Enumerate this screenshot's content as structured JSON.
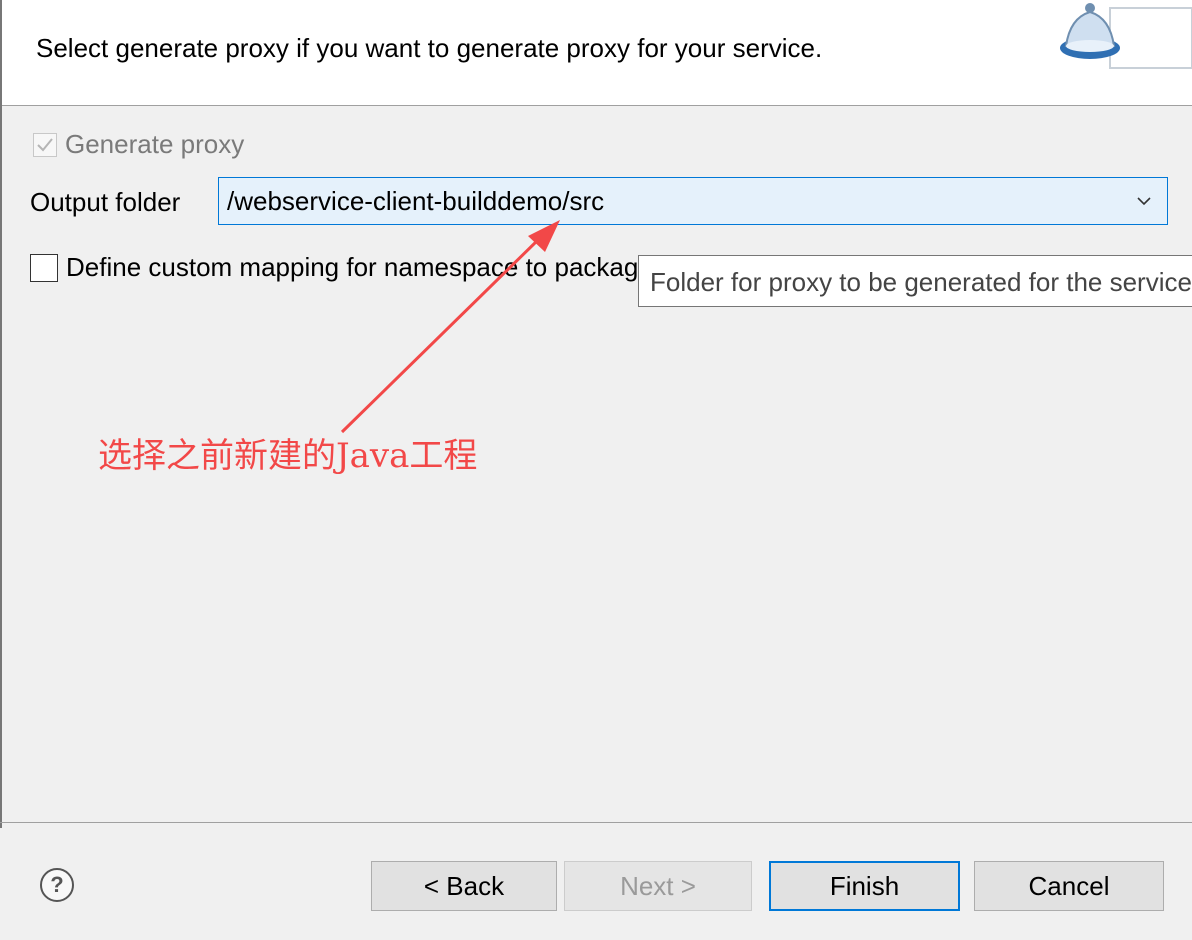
{
  "header": {
    "description": "Select generate proxy if you want to generate proxy for your service."
  },
  "generate_proxy": {
    "label": "Generate proxy",
    "checked": true,
    "enabled": false
  },
  "output_folder": {
    "label": "Output folder",
    "value": "/webservice-client-builddemo/src"
  },
  "custom_mapping": {
    "label": "Define custom mapping for namespace to package",
    "checked": false
  },
  "tooltip": {
    "text": "Folder for proxy to be generated for the service"
  },
  "annotation": {
    "text": "选择之前新建的Java工程",
    "color": "#f24848"
  },
  "footer": {
    "help_icon": "help-icon",
    "back_label": "< Back",
    "next_label": "Next >",
    "finish_label": "Finish",
    "cancel_label": "Cancel"
  },
  "colors": {
    "focus_border": "#0078d7",
    "combo_background": "#e5f1fb"
  }
}
